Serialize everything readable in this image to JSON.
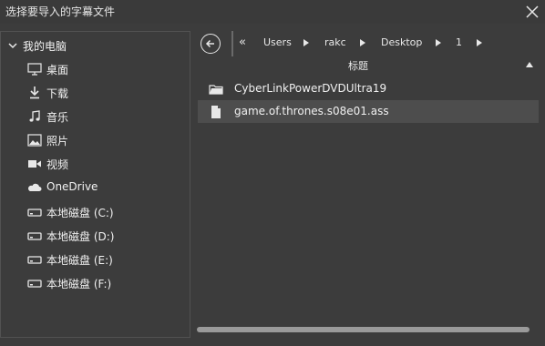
{
  "window": {
    "title": "选择要导入的字幕文件"
  },
  "sidebar": {
    "root_label": "我的电脑",
    "items": [
      {
        "label": "桌面",
        "icon": "desktop-icon"
      },
      {
        "label": "下载",
        "icon": "download-icon"
      },
      {
        "label": "音乐",
        "icon": "music-icon"
      },
      {
        "label": "照片",
        "icon": "photo-icon"
      },
      {
        "label": "视频",
        "icon": "video-icon"
      },
      {
        "label": "OneDrive",
        "icon": "cloud-icon"
      },
      {
        "label": "本地磁盘 (C:)",
        "icon": "drive-icon"
      },
      {
        "label": "本地磁盘 (D:)",
        "icon": "drive-icon"
      },
      {
        "label": "本地磁盘 (E:)",
        "icon": "drive-icon"
      },
      {
        "label": "本地磁盘 (F:)",
        "icon": "drive-icon"
      }
    ]
  },
  "breadcrumb": {
    "overflow": "«",
    "segments": [
      "Users",
      "rakc",
      "Desktop",
      "1"
    ]
  },
  "file_list": {
    "column_header": "标题",
    "sort": "ascending",
    "items": [
      {
        "name": "CyberLinkPowerDVDUltra19",
        "type": "folder",
        "icon": "folder-icon"
      },
      {
        "name": "game.of.thrones.s08e01.ass",
        "type": "file",
        "icon": "file-icon",
        "selected": true
      }
    ]
  },
  "colors": {
    "background": "#3c3c3c",
    "selection": "#4d4d4d",
    "text": "#f0f0f0"
  }
}
